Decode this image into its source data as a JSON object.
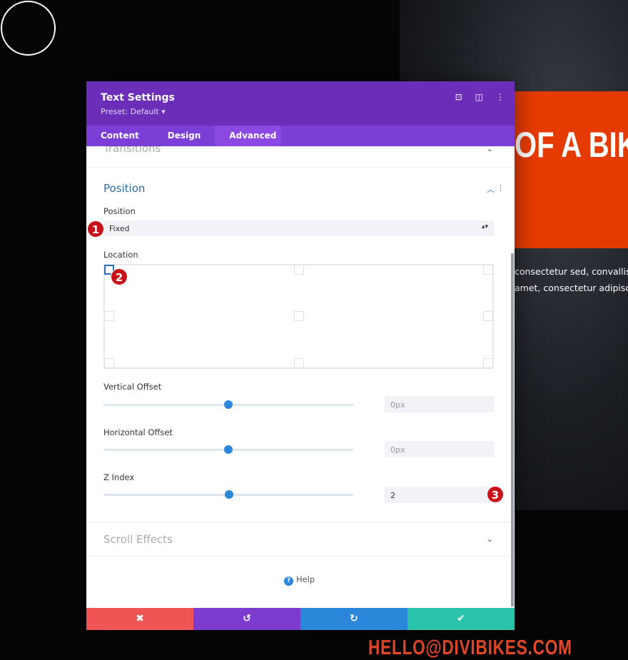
{
  "background": {
    "hero_text": "OF A BIKE",
    "body_lines": [
      "consectetur sed, convallis at",
      "amet, consectetur adipiscing"
    ],
    "email": "HELLO@DIVIBIKES.COM",
    "colors": {
      "accent": "#e63b00"
    }
  },
  "modal": {
    "title": "Text Settings",
    "preset": "Preset: Default ▾",
    "header_icons": [
      "focus-icon",
      "split-view-icon",
      "more-options-icon"
    ],
    "tabs": [
      {
        "label": "Content"
      },
      {
        "label": "Design"
      },
      {
        "label": "Advanced"
      }
    ],
    "active_tab": "Advanced",
    "transitions_label": "Transitions",
    "position": {
      "title": "Position",
      "position_label": "Position",
      "position_value": "Fixed",
      "location_label": "Location",
      "selected_location": "top-left",
      "vertical_offset": {
        "label": "Vertical Offset",
        "value": "0px",
        "slider_percent": 50
      },
      "horizontal_offset": {
        "label": "Horizontal Offset",
        "value": "0px",
        "slider_percent": 50
      },
      "z_index": {
        "label": "Z Index",
        "value": "2",
        "slider_percent": 50
      }
    },
    "scroll_effects_label": "Scroll Effects",
    "help_label": "Help",
    "footer": {
      "cancel": "✖",
      "undo": "↺",
      "redo": "↻",
      "save": "✔"
    },
    "colors": {
      "header": "#6c2eb9",
      "tabs": "#7b3ed6",
      "cancel": "#ef5555",
      "undo": "#7e3bd0",
      "redo": "#2b87da",
      "save": "#29c4a9"
    }
  },
  "markers": [
    "1",
    "2",
    "3"
  ]
}
